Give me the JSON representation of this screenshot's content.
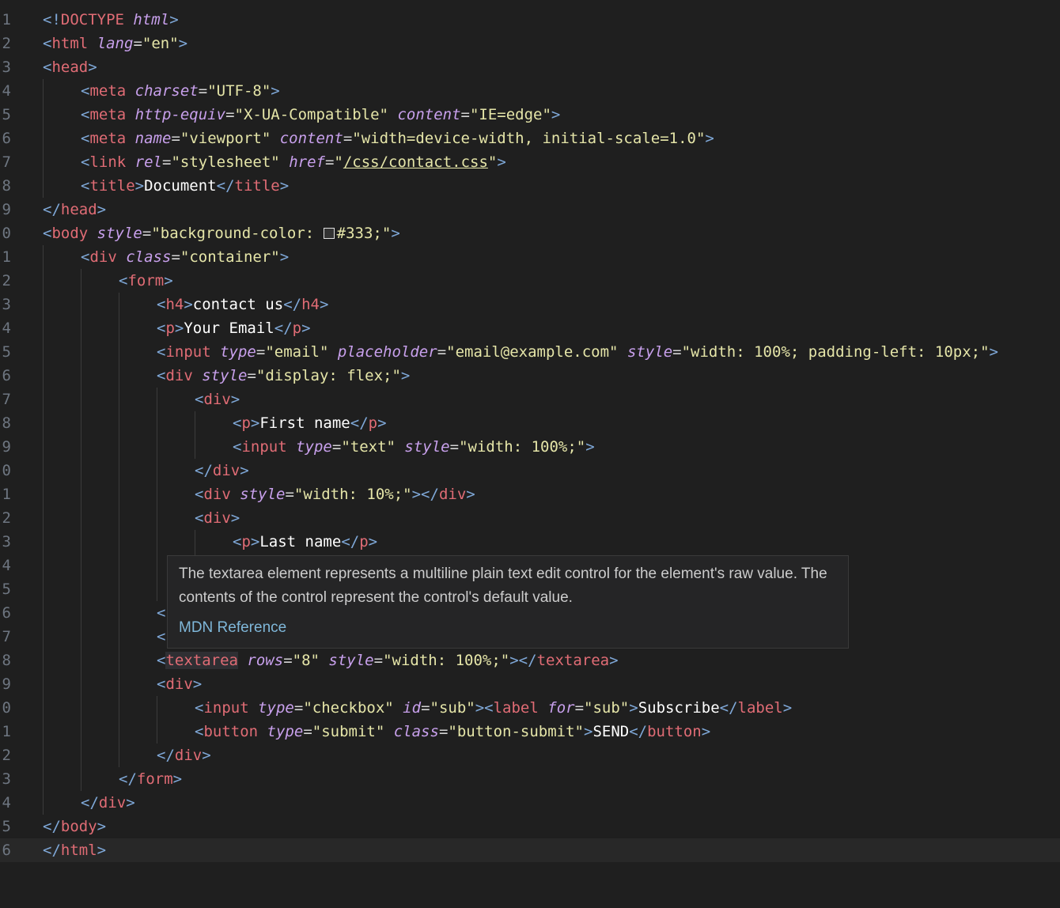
{
  "editor": {
    "lines": [
      {
        "no": "1",
        "indent": 0,
        "html": "<span class='t-bracket'>&lt;!</span><span class='t-tag'>DOCTYPE</span> <span class='t-attr'>html</span><span class='t-bracket'>&gt;</span>"
      },
      {
        "no": "2",
        "indent": 0,
        "html": "<span class='t-bracket'>&lt;</span><span class='t-tag'>html</span> <span class='t-attr'>lang</span><span class='t-eq'>=</span><span class='t-str'>\"en\"</span><span class='t-bracket'>&gt;</span>"
      },
      {
        "no": "3",
        "indent": 0,
        "html": "<span class='t-bracket'>&lt;</span><span class='t-tag'>head</span><span class='t-bracket'>&gt;</span>"
      },
      {
        "no": "4",
        "indent": 1,
        "html": "<span class='t-bracket'>&lt;</span><span class='t-tag'>meta</span> <span class='t-attr'>charset</span><span class='t-eq'>=</span><span class='t-str'>\"UTF-8\"</span><span class='t-bracket'>&gt;</span>"
      },
      {
        "no": "5",
        "indent": 1,
        "html": "<span class='t-bracket'>&lt;</span><span class='t-tag'>meta</span> <span class='t-attr'>http-equiv</span><span class='t-eq'>=</span><span class='t-str'>\"X-UA-Compatible\"</span> <span class='t-attr'>content</span><span class='t-eq'>=</span><span class='t-str'>\"IE=edge\"</span><span class='t-bracket'>&gt;</span>"
      },
      {
        "no": "6",
        "indent": 1,
        "html": "<span class='t-bracket'>&lt;</span><span class='t-tag'>meta</span> <span class='t-attr'>name</span><span class='t-eq'>=</span><span class='t-str'>\"viewport\"</span> <span class='t-attr'>content</span><span class='t-eq'>=</span><span class='t-str'>\"width=device-width, initial-scale=1.0\"</span><span class='t-bracket'>&gt;</span>"
      },
      {
        "no": "7",
        "indent": 1,
        "html": "<span class='t-bracket'>&lt;</span><span class='t-tag'>link</span> <span class='t-attr'>rel</span><span class='t-eq'>=</span><span class='t-str'>\"stylesheet\"</span> <span class='t-attr'>href</span><span class='t-eq'>=</span><span class='t-str'>\"<span class='t-link'>/css/contact.css</span>\"</span><span class='t-bracket'>&gt;</span>"
      },
      {
        "no": "8",
        "indent": 1,
        "html": "<span class='t-bracket'>&lt;</span><span class='t-tag'>title</span><span class='t-bracket'>&gt;</span><span class='t-text'>Document</span><span class='t-bracket'>&lt;/</span><span class='t-tag'>title</span><span class='t-bracket'>&gt;</span>"
      },
      {
        "no": "9",
        "indent": 0,
        "html": "<span class='t-bracket'>&lt;/</span><span class='t-tag'>head</span><span class='t-bracket'>&gt;</span>"
      },
      {
        "no": "0",
        "indent": 0,
        "html": "<span class='t-bracket'>&lt;</span><span class='t-tag'>body</span> <span class='t-attr'>style</span><span class='t-eq'>=</span><span class='t-str'>\"background-color: <span class='swatch'></span>#333;\"</span><span class='t-bracket'>&gt;</span>"
      },
      {
        "no": "1",
        "indent": 1,
        "html": "<span class='t-bracket'>&lt;</span><span class='t-tag'>div</span> <span class='t-attr'>class</span><span class='t-eq'>=</span><span class='t-str'>\"container\"</span><span class='t-bracket'>&gt;</span>"
      },
      {
        "no": "2",
        "indent": 2,
        "html": "<span class='t-bracket'>&lt;</span><span class='t-tag'>form</span><span class='t-bracket'>&gt;</span>"
      },
      {
        "no": "3",
        "indent": 3,
        "html": "<span class='t-bracket'>&lt;</span><span class='t-tag'>h4</span><span class='t-bracket'>&gt;</span><span class='t-text'>contact us</span><span class='t-bracket'>&lt;/</span><span class='t-tag'>h4</span><span class='t-bracket'>&gt;</span>"
      },
      {
        "no": "4",
        "indent": 3,
        "html": "<span class='t-bracket'>&lt;</span><span class='t-tag'>p</span><span class='t-bracket'>&gt;</span><span class='t-text'>Your Email</span><span class='t-bracket'>&lt;/</span><span class='t-tag'>p</span><span class='t-bracket'>&gt;</span>"
      },
      {
        "no": "5",
        "indent": 3,
        "html": "<span class='t-bracket'>&lt;</span><span class='t-tag'>input</span> <span class='t-attr'>type</span><span class='t-eq'>=</span><span class='t-str'>\"email\"</span> <span class='t-attr'>placeholder</span><span class='t-eq'>=</span><span class='t-str'>\"email@example.com\"</span> <span class='t-attr'>style</span><span class='t-eq'>=</span><span class='t-str'>\"width: 100%; padding-left: 10px;\"</span><span class='t-bracket'>&gt;</span>"
      },
      {
        "no": "6",
        "indent": 3,
        "html": "<span class='t-bracket'>&lt;</span><span class='t-tag'>div</span> <span class='t-attr'>style</span><span class='t-eq'>=</span><span class='t-str'>\"display: flex;\"</span><span class='t-bracket'>&gt;</span>"
      },
      {
        "no": "7",
        "indent": 4,
        "html": "<span class='t-bracket'>&lt;</span><span class='t-tag'>div</span><span class='t-bracket'>&gt;</span>"
      },
      {
        "no": "8",
        "indent": 5,
        "html": "<span class='t-bracket'>&lt;</span><span class='t-tag'>p</span><span class='t-bracket'>&gt;</span><span class='t-text'>First name</span><span class='t-bracket'>&lt;/</span><span class='t-tag'>p</span><span class='t-bracket'>&gt;</span>"
      },
      {
        "no": "9",
        "indent": 5,
        "html": "<span class='t-bracket'>&lt;</span><span class='t-tag'>input</span> <span class='t-attr'>type</span><span class='t-eq'>=</span><span class='t-str'>\"text\"</span> <span class='t-attr'>style</span><span class='t-eq'>=</span><span class='t-str'>\"width: 100%;\"</span><span class='t-bracket'>&gt;</span>"
      },
      {
        "no": "0",
        "indent": 4,
        "html": "<span class='t-bracket'>&lt;/</span><span class='t-tag'>div</span><span class='t-bracket'>&gt;</span>"
      },
      {
        "no": "1",
        "indent": 4,
        "html": "<span class='t-bracket'>&lt;</span><span class='t-tag'>div</span> <span class='t-attr'>style</span><span class='t-eq'>=</span><span class='t-str'>\"width: 10%;\"</span><span class='t-bracket'>&gt;&lt;/</span><span class='t-tag'>div</span><span class='t-bracket'>&gt;</span>"
      },
      {
        "no": "2",
        "indent": 4,
        "html": "<span class='t-bracket'>&lt;</span><span class='t-tag'>div</span><span class='t-bracket'>&gt;</span>"
      },
      {
        "no": "3",
        "indent": 5,
        "html": "<span class='t-bracket'>&lt;</span><span class='t-tag'>p</span><span class='t-bracket'>&gt;</span><span class='t-text'>Last name</span><span class='t-bracket'>&lt;/</span><span class='t-tag'>p</span><span class='t-bracket'>&gt;</span>"
      },
      {
        "no": "4",
        "indent": 5,
        "html": ""
      },
      {
        "no": "5",
        "indent": 4,
        "html": ""
      },
      {
        "no": "6",
        "indent": 3,
        "html": "<span class='t-bracket'>&lt;</span>"
      },
      {
        "no": "7",
        "indent": 3,
        "html": "<span class='t-bracket'>&lt;</span>"
      },
      {
        "no": "8",
        "indent": 3,
        "html": "<span class='t-bracket'>&lt;</span><span class='t-tag hl-word'>textarea</span> <span class='t-attr'>rows</span><span class='t-eq'>=</span><span class='t-str'>\"8\"</span> <span class='t-attr'>style</span><span class='t-eq'>=</span><span class='t-str'>\"width: 100%;\"</span><span class='t-bracket'>&gt;&lt;/</span><span class='t-tag'>textarea</span><span class='t-bracket'>&gt;</span>"
      },
      {
        "no": "9",
        "indent": 3,
        "html": "<span class='t-bracket'>&lt;</span><span class='t-tag'>div</span><span class='t-bracket'>&gt;</span>"
      },
      {
        "no": "0",
        "indent": 4,
        "html": "<span class='t-bracket'>&lt;</span><span class='t-tag'>input</span> <span class='t-attr'>type</span><span class='t-eq'>=</span><span class='t-str'>\"checkbox\"</span> <span class='t-attr'>id</span><span class='t-eq'>=</span><span class='t-str'>\"sub\"</span><span class='t-bracket'>&gt;&lt;</span><span class='t-tag'>label</span> <span class='t-attr'>for</span><span class='t-eq'>=</span><span class='t-str'>\"sub\"</span><span class='t-bracket'>&gt;</span><span class='t-text'>Subscribe</span><span class='t-bracket'>&lt;/</span><span class='t-tag'>label</span><span class='t-bracket'>&gt;</span>"
      },
      {
        "no": "1",
        "indent": 4,
        "html": "<span class='t-bracket'>&lt;</span><span class='t-tag'>button</span> <span class='t-attr'>type</span><span class='t-eq'>=</span><span class='t-str'>\"submit\"</span> <span class='t-attr'>class</span><span class='t-eq'>=</span><span class='t-str'>\"button-submit\"</span><span class='t-bracket'>&gt;</span><span class='t-text'>SEND</span><span class='t-bracket'>&lt;/</span><span class='t-tag'>button</span><span class='t-bracket'>&gt;</span>"
      },
      {
        "no": "2",
        "indent": 3,
        "html": "<span class='t-bracket'>&lt;/</span><span class='t-tag'>div</span><span class='t-bracket'>&gt;</span>"
      },
      {
        "no": "3",
        "indent": 2,
        "html": "<span class='t-bracket'>&lt;/</span><span class='t-tag'>form</span><span class='t-bracket'>&gt;</span>"
      },
      {
        "no": "4",
        "indent": 1,
        "html": "<span class='t-bracket'>&lt;/</span><span class='t-tag'>div</span><span class='t-bracket'>&gt;</span>"
      },
      {
        "no": "5",
        "indent": 0,
        "html": "<span class='t-bracket'>&lt;/</span><span class='t-tag'>body</span><span class='t-bracket'>&gt;</span>"
      },
      {
        "no": "6",
        "indent": 0,
        "current": true,
        "html": "<span class='t-bracket'>&lt;/</span><span class='t-tag'>html</span><span class='t-bracket'>&gt;</span>"
      }
    ]
  },
  "tooltip": {
    "description": "The textarea element represents a multiline plain text edit control for the element's raw value. The contents of the control represent the control's default value.",
    "link_label": "MDN Reference"
  },
  "colors": {
    "background": "#1f1f1f",
    "tag": "#e06c75",
    "attribute": "#c8a0ec",
    "string": "#e5e5a8",
    "bracket": "#7fa8d8",
    "link": "#7fb7d9"
  }
}
